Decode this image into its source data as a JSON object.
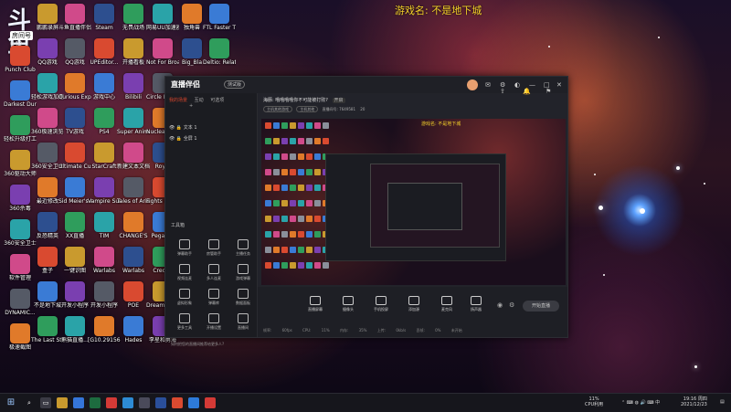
{
  "game_title": "游戏名:  不是地下城",
  "logo": {
    "text": "斗鱼",
    "tag": "房间号",
    "number": "640"
  },
  "desktop": {
    "col1": [
      "Punch Club",
      "Darkest Dungeon®",
      "轻松升级打工篇",
      "360驱动大师",
      "360杀毒",
      "360安全卫士",
      "软件管理",
      "DYNAMIC...",
      "极速截图",
      "地下城战记..."
    ],
    "col2": [
      "鹏鹏录屏",
      "QQ游戏",
      "轻松游戏加速器",
      "360极速浏览器",
      "360安全卫士",
      "最近修改",
      "反恐精英",
      "盒子",
      "不是地下城",
      "The Last Stand A..."
    ],
    "col3": [
      "斗鱼直播伴侣",
      "QQ游戏",
      "Curious Expedition",
      "TV游戏",
      "Ultimate Custom Night",
      "Sid Meier's Civilization",
      "XX直播",
      "一键识图",
      "开发小程序",
      "熊猫直播..."
    ],
    "col4": [
      "Steam",
      "UPEditor...",
      "游戏中心",
      "PS4",
      "StarCraft",
      "Vampire Survivors",
      "TIM",
      "Warlabs",
      "开发小程序",
      "[G10.29156]"
    ],
    "col5": [
      "无畏战场",
      "开播看板",
      "Bilibili",
      "Super Animal",
      "新建文本文档",
      "Tales of Arise",
      "CHANGE'S",
      "Warlabs",
      "POE",
      "Hades"
    ],
    "col6": [
      "网易UU加速器",
      "Not For Broadcast",
      "Circle Empires",
      "Nuclear Throne",
      "Royal",
      "Fights in Tight Spaces",
      "Pegasus",
      "Credipi",
      "Dreams Deck",
      "李星和勇海"
    ],
    "col7": [
      "独角兽",
      "Big_Bla",
      "Darkest",
      "Flat Moon",
      "Inscryption",
      "Loop Hero",
      "Dead Cells",
      "Crown",
      "Rogue",
      "Dredgers"
    ],
    "col8": [
      "FTL Faster Than Light",
      "Deltio: Relative",
      "Merge & Blade",
      "Monster Prom",
      "111",
      "YY游戏大厅",
      "Warlabs...",
      "",
      "",
      ""
    ]
  },
  "window": {
    "brand": "直播伴侣",
    "brand_tag": "测试版",
    "tabs": [
      "我的场景",
      "互动",
      "可选项"
    ],
    "scenes": [
      "文本 1",
      "全屏 1"
    ],
    "tool_section": "工具箱",
    "tools": [
      "弹幕助手",
      "房管助手",
      "主播任务",
      "视频连麦",
      "多人连麦",
      "游戏弹幕",
      "虚拟形象",
      "弹幕库",
      "数据面板",
      "更多工具",
      "开播设置",
      "直播间"
    ],
    "side_note": "如何把您的直播间推荐给更多人?",
    "room_title": "海豚: 哦哦哦哦你不可能被打败?",
    "room_chip": "开启",
    "room_pills": [
      "主机其他游戏",
      "主机其他"
    ],
    "room_meta": "直播间号: 7649581",
    "room_count": "20",
    "inner_title": "游戏名:  不是地下城",
    "bottom_buttons": [
      "直播屏幕",
      "摄像头",
      "手机投屏",
      "添加源",
      "麦克风",
      "扬声器"
    ],
    "start_label": "开始直播",
    "status_items": [
      "帧率: 60fps",
      "CPU: 11%",
      "内存: 35%",
      "上传: 0kb/s",
      "丢帧: 0%",
      "未开始"
    ]
  },
  "taskbar": {
    "cpu": "11%",
    "cpu_label": "CPU利用",
    "time": "19:16",
    "date": "2021/12/23",
    "weekday": "周四"
  },
  "colors": {
    "accent": "#d5442c",
    "title_yellow": "#f5d12a"
  }
}
